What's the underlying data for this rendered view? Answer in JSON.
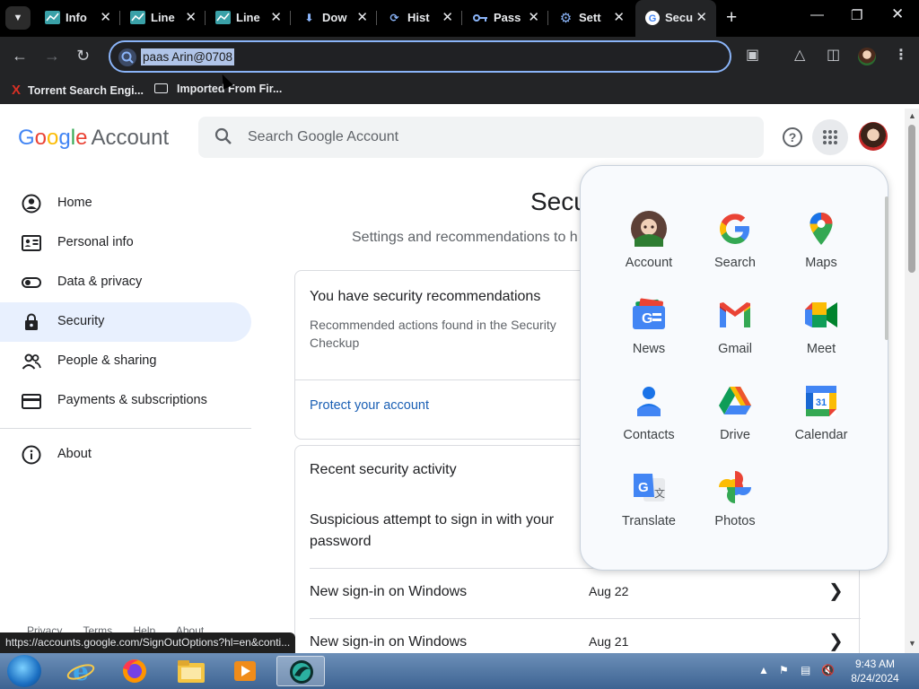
{
  "browser": {
    "tabs": [
      {
        "title": "Info",
        "icon": "chart-icon"
      },
      {
        "title": "Line",
        "icon": "chart-icon"
      },
      {
        "title": "Line",
        "icon": "chart-icon"
      },
      {
        "title": "Dow",
        "icon": "download-icon"
      },
      {
        "title": "Hist",
        "icon": "history-icon"
      },
      {
        "title": "Pass",
        "icon": "key-icon"
      },
      {
        "title": "Sett",
        "icon": "gear-icon"
      },
      {
        "title": "Secu",
        "icon": "google-g-icon",
        "active": true
      }
    ],
    "address": "paas Arin@0708",
    "bookmarks": [
      "Torrent Search Engi...",
      "Imported From Fir..."
    ]
  },
  "header": {
    "logo_google": "Google",
    "logo_account": "Account",
    "search_placeholder": "Search Google Account",
    "help_icon_text": "?"
  },
  "nav": {
    "items": [
      {
        "label": "Home",
        "icon": "home-icon"
      },
      {
        "label": "Personal info",
        "icon": "id-card-icon"
      },
      {
        "label": "Data & privacy",
        "icon": "toggle-icon"
      },
      {
        "label": "Security",
        "icon": "lock-icon",
        "active": true
      },
      {
        "label": "People & sharing",
        "icon": "people-icon"
      },
      {
        "label": "Payments & subscriptions",
        "icon": "card-icon"
      },
      {
        "label": "About",
        "icon": "info-icon"
      }
    ],
    "footer": [
      "Privacy",
      "Terms",
      "Help",
      "About"
    ]
  },
  "main": {
    "title": "Secu",
    "subtitle": "Settings and recommendations to h",
    "recommendations": {
      "title": "You have security recommendations",
      "description": "Recommended actions found in the Security Checkup",
      "link": "Protect your account"
    },
    "activity": {
      "title": "Recent security activity",
      "rows": [
        {
          "text": "Suspicious attempt to sign in with your password",
          "date": ""
        },
        {
          "text": "New sign-in on Windows",
          "date": "Aug 22"
        },
        {
          "text": "New sign-in on Windows",
          "date": "Aug 21"
        }
      ]
    }
  },
  "apps_popup": {
    "apps": [
      {
        "label": "Account",
        "icon": "account-avatar-icon"
      },
      {
        "label": "Search",
        "icon": "google-search-icon"
      },
      {
        "label": "Maps",
        "icon": "maps-pin-icon"
      },
      {
        "label": "News",
        "icon": "news-icon"
      },
      {
        "label": "Gmail",
        "icon": "gmail-icon"
      },
      {
        "label": "Meet",
        "icon": "meet-icon"
      },
      {
        "label": "Contacts",
        "icon": "contacts-icon"
      },
      {
        "label": "Drive",
        "icon": "drive-icon"
      },
      {
        "label": "Calendar",
        "icon": "calendar-icon",
        "icon_text": "31"
      },
      {
        "label": "Translate",
        "icon": "translate-icon"
      },
      {
        "label": "Photos",
        "icon": "photos-icon"
      }
    ]
  },
  "status_url": "https://accounts.google.com/SignOutOptions?hl=en&conti...",
  "taskbar": {
    "time": "9:43 AM",
    "date": "8/24/2024"
  },
  "colors": {
    "accent": "#1a73e8",
    "active_nav_bg": "#e8f0fe",
    "link": "#1a5fb4",
    "browser_dark": "#232426"
  }
}
